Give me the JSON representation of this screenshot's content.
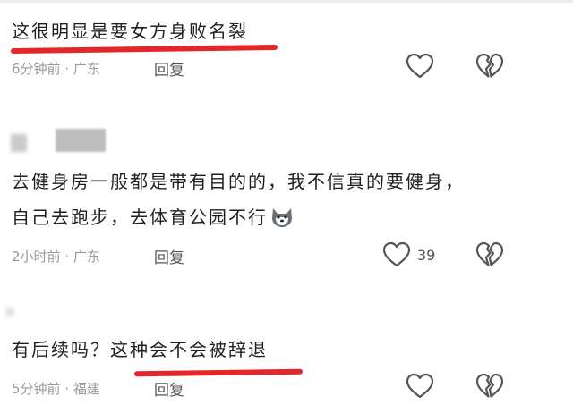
{
  "comments": [
    {
      "text": "这很明显是要女方身败名裂",
      "time": "6分钟前",
      "location": "广东",
      "reply_label": "回复",
      "like_count": ""
    },
    {
      "user": "",
      "line1": "去健身房一般都是带有目的的，我不信真的要健身，",
      "line2": "自己去跑步，去体育公园不行",
      "time": "2小时前",
      "location": "广东",
      "reply_label": "回复",
      "like_count": "39"
    },
    {
      "text": "有后续吗？这种会不会被辞退",
      "time": "5分钟前",
      "location": "福建",
      "reply_label": "回复",
      "like_count": ""
    }
  ],
  "meta_separator": "·",
  "colors": {
    "underline": "#e3262a",
    "meta": "#9a9a9a",
    "icon": "#555555"
  },
  "icons": [
    "heart-outline-icon",
    "broken-heart-icon",
    "dog-face-emoji"
  ]
}
